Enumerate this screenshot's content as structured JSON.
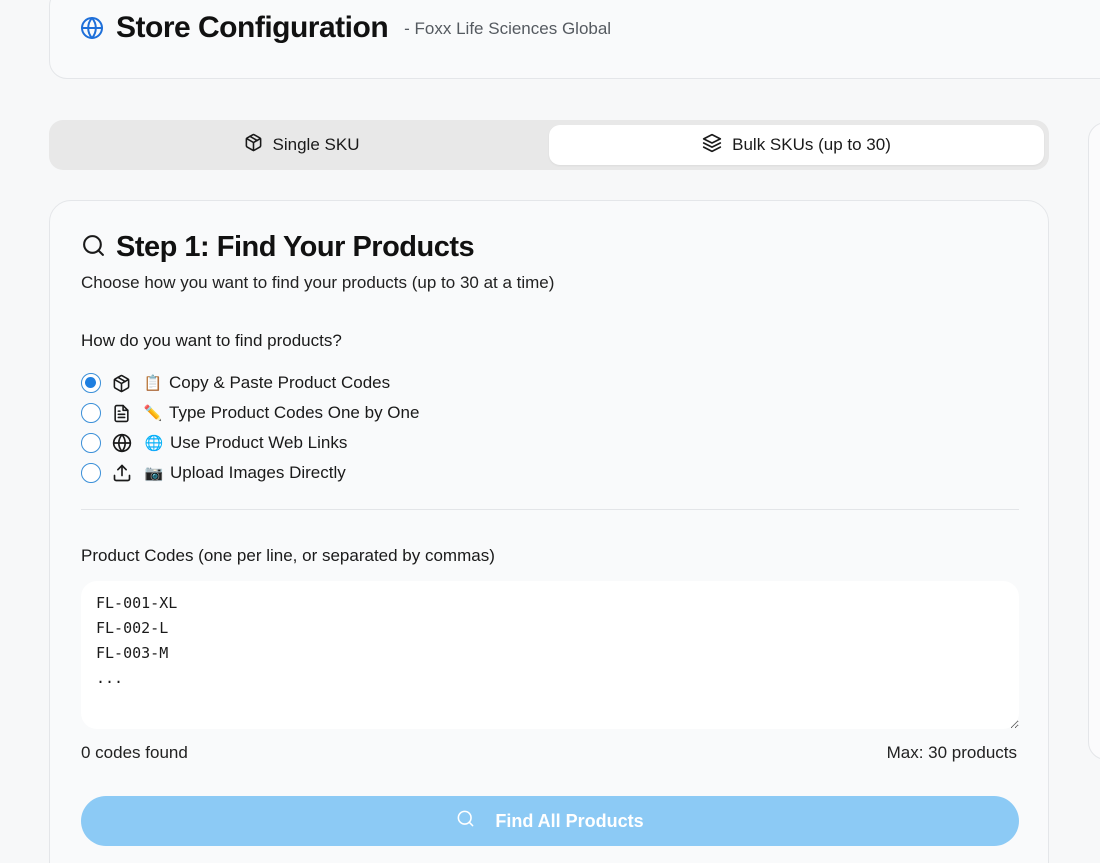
{
  "header": {
    "title": "Store Configuration",
    "subtitle": "- Foxx Life Sciences Global",
    "icon": "globe-icon"
  },
  "tabs": [
    {
      "label": "Single SKU",
      "icon": "box-icon",
      "active": false
    },
    {
      "label": "Bulk SKUs (up to 30)",
      "icon": "layers-icon",
      "active": true
    }
  ],
  "step": {
    "title": "Step 1: Find Your Products",
    "description": "Choose how you want to find your products (up to 30 at a time)",
    "question": "How do you want to find products?",
    "options": [
      {
        "icon": "box-icon",
        "emoji": "📋",
        "label": "Copy & Paste Product Codes",
        "selected": true
      },
      {
        "icon": "file-icon",
        "emoji": "✏️",
        "label": "Type Product Codes One by One",
        "selected": false
      },
      {
        "icon": "globe-icon",
        "emoji": "🌐",
        "label": "Use Product Web Links",
        "selected": false
      },
      {
        "icon": "upload-icon",
        "emoji": "📷",
        "label": "Upload Images Directly",
        "selected": false
      }
    ]
  },
  "codes": {
    "label": "Product Codes (one per line, or separated by commas)",
    "placeholder": "FL-001-XL\nFL-002-L\nFL-003-M\n...",
    "value": "",
    "found_text": "0 codes found",
    "max_text": "Max: 30 products"
  },
  "find_button": {
    "label": "Find All Products",
    "icon": "search-icon"
  },
  "colors": {
    "accent": "#1e7fe0",
    "button_disabled": "#8ccaf5",
    "background": "#f7f8f9"
  }
}
